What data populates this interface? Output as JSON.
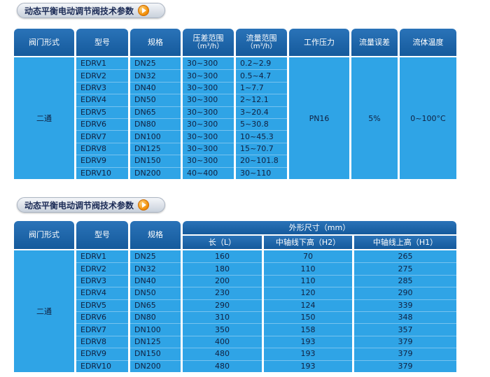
{
  "section1": {
    "title": "动态平衡电动调节阀技术参数",
    "headers": {
      "form": "阀门形式",
      "model": "型号",
      "spec": "规格",
      "diff_pressure": "压差范围",
      "diff_pressure_unit": "（m³/h）",
      "flow_range": "流量范围",
      "flow_range_unit": "（m³/h）",
      "working_pressure": "工作压力",
      "flow_error": "流量误差",
      "fluid_temp": "流体温度"
    },
    "form_value": "二通",
    "working_pressure_value": "PN16",
    "flow_error_value": "5%",
    "fluid_temp_value": "0~100°C",
    "rows": [
      {
        "model": "EDRV1",
        "spec": "DN25",
        "diff": "30~300",
        "flow": "0.2~2.9"
      },
      {
        "model": "EDRV2",
        "spec": "DN32",
        "diff": "30~300",
        "flow": "0.5~4.7"
      },
      {
        "model": "EDRV3",
        "spec": "DN40",
        "diff": "30~300",
        "flow": "1~7.7"
      },
      {
        "model": "EDRV4",
        "spec": "DN50",
        "diff": "30~300",
        "flow": "2~12.1"
      },
      {
        "model": "EDRV5",
        "spec": "DN65",
        "diff": "30~300",
        "flow": "3~20.4"
      },
      {
        "model": "EDRV6",
        "spec": "DN80",
        "diff": "30~300",
        "flow": "5~30.8"
      },
      {
        "model": "EDRV7",
        "spec": "DN100",
        "diff": "30~300",
        "flow": "10~45.3"
      },
      {
        "model": "EDRV8",
        "spec": "DN125",
        "diff": "30~300",
        "flow": "15~70.7"
      },
      {
        "model": "EDRV9",
        "spec": "DN150",
        "diff": "30~300",
        "flow": "20~101.8"
      },
      {
        "model": "EDRV10",
        "spec": "DN200",
        "diff": "40~400",
        "flow": "30~110"
      }
    ]
  },
  "section2": {
    "title": "动态平衡电动调节阀技术参数",
    "headers": {
      "form": "阀门形式",
      "model": "型号",
      "spec": "规格",
      "dims": "外形尺寸（mm）",
      "length": "长（L）",
      "below": "中轴线下高（H2）",
      "above": "中轴线上高（H1）"
    },
    "form_value": "二通",
    "rows": [
      {
        "model": "EDRV1",
        "spec": "DN25",
        "l": "160",
        "h2": "70",
        "h1": "265"
      },
      {
        "model": "EDRV2",
        "spec": "DN32",
        "l": "180",
        "h2": "110",
        "h1": "275"
      },
      {
        "model": "EDRV3",
        "spec": "DN40",
        "l": "200",
        "h2": "110",
        "h1": "285"
      },
      {
        "model": "EDRV4",
        "spec": "DN50",
        "l": "230",
        "h2": "120",
        "h1": "290"
      },
      {
        "model": "EDRV5",
        "spec": "DN65",
        "l": "290",
        "h2": "124",
        "h1": "339"
      },
      {
        "model": "EDRV6",
        "spec": "DN80",
        "l": "310",
        "h2": "150",
        "h1": "348"
      },
      {
        "model": "EDRV7",
        "spec": "DN100",
        "l": "350",
        "h2": "158",
        "h1": "357"
      },
      {
        "model": "EDRV8",
        "spec": "DN125",
        "l": "400",
        "h2": "193",
        "h1": "379"
      },
      {
        "model": "EDRV9",
        "spec": "DN150",
        "l": "480",
        "h2": "193",
        "h1": "379"
      },
      {
        "model": "EDRV10",
        "spec": "DN200",
        "l": "480",
        "h2": "193",
        "h1": "379"
      }
    ]
  },
  "colors": {
    "header_blue": "#1b62a6",
    "body_blue": "#2fa4e6",
    "badge_arrow": "#f08a00"
  }
}
